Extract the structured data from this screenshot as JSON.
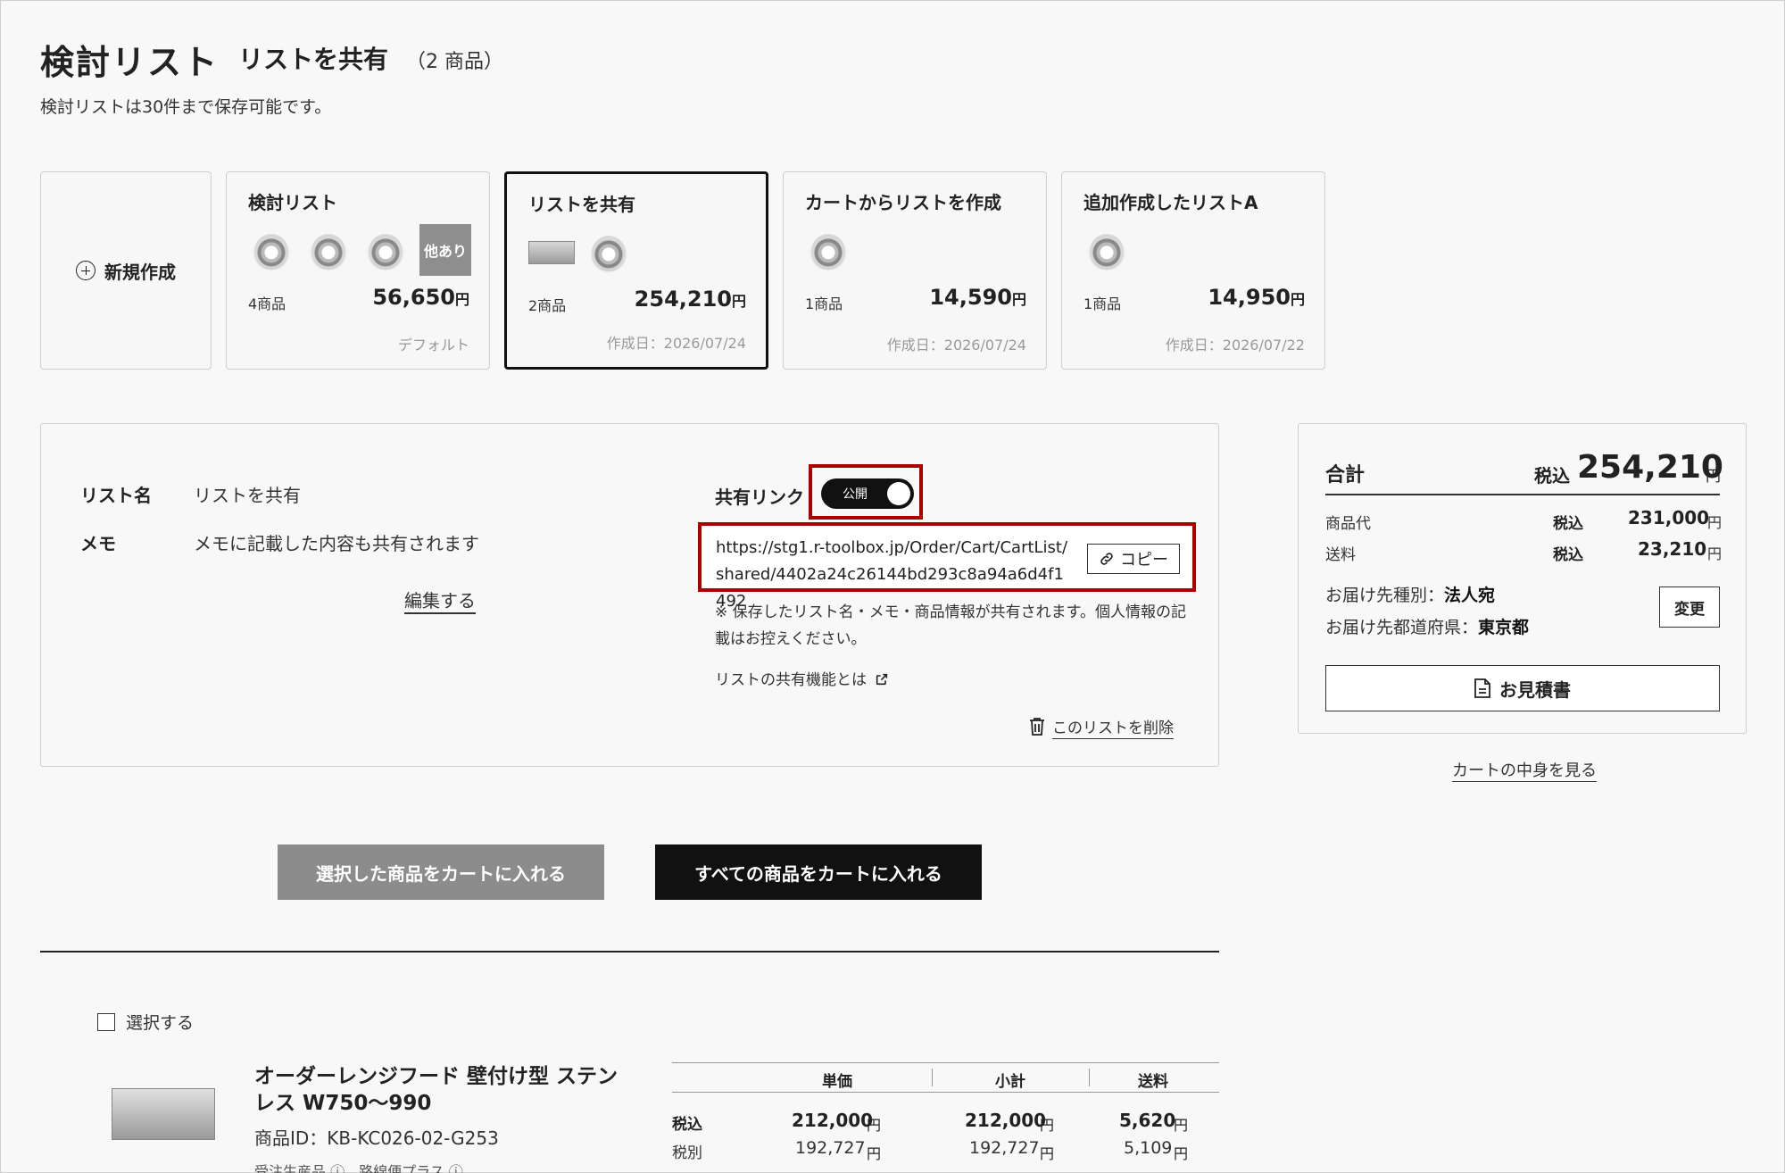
{
  "header": {
    "title": "検討リスト",
    "current_list": "リストを共有",
    "item_count": "（2 商品）",
    "note": "検討リストは30件まで保存可能です。"
  },
  "new_card": {
    "label": "新規作成"
  },
  "cards": [
    {
      "title": "検討リスト",
      "count": "4商品",
      "price": "56,650",
      "yen": "円",
      "date": "デフォルト",
      "more": "他あり"
    },
    {
      "title": "リストを共有",
      "count": "2商品",
      "price": "254,210",
      "yen": "円",
      "date": "作成日：2026/07/24"
    },
    {
      "title": "カートからリストを作成",
      "count": "1商品",
      "price": "14,590",
      "yen": "円",
      "date": "作成日：2026/07/24"
    },
    {
      "title": "追加作成したリストA",
      "count": "1商品",
      "price": "14,950",
      "yen": "円",
      "date": "作成日：2026/07/22"
    }
  ],
  "detail": {
    "name_label": "リスト名",
    "name_value": "リストを共有",
    "memo_label": "メモ",
    "memo_value": "メモに記載した内容も共有されます",
    "edit_link": "編集する",
    "share_label": "共有リンク",
    "toggle_label": "公開",
    "share_url": "https://stg1.r-toolbox.jp/Order/Cart/CartList/shared/4402a24c26144bd293c8a94a6d4f1492",
    "copy_label": "コピー",
    "notice": "※ 保存したリスト名・メモ・商品情報が共有されます。個人情報の記載はお控えください。",
    "about_link": "リストの共有機能とは",
    "delete_link": "このリストを削除"
  },
  "summary": {
    "title": "合計",
    "tax_in": "税込",
    "total": "254,210",
    "yen": "円",
    "goods_label": "商品代",
    "goods_value": "231,000",
    "shipping_label": "送料",
    "shipping_value": "23,210",
    "dest_type_label": "お届け先種別：",
    "dest_type_value": "法人宛",
    "dest_pref_label": "お届け先都道府県：",
    "dest_pref_value": "東京都",
    "change_btn": "変更",
    "quote_btn": "お見積書",
    "cart_link": "カートの中身を見る"
  },
  "actions": {
    "add_selected": "選択した商品をカートに入れる",
    "add_all": "すべての商品をカートに入れる"
  },
  "product": {
    "select_label": "選択する",
    "name": "オーダーレンジフード 壁付け型 ステンレス W750〜990",
    "id": "商品ID：KB-KC026-02-G253",
    "tags": "受注生産品 ⓘ　路線便プラス ⓘ",
    "col_unit": "単価",
    "col_subtotal": "小計",
    "col_shipping": "送料",
    "tax_in": "税込",
    "tax_ex": "税別",
    "unit_in": "212,000",
    "subtotal_in": "212,000",
    "shipping_in": "5,620",
    "unit_ex": "192,727",
    "subtotal_ex": "192,727",
    "shipping_ex": "5,109",
    "yen": "円"
  },
  "colors": {
    "accent_red": "#aa0000",
    "black": "#111111",
    "gray_button": "#8c8c8c"
  }
}
